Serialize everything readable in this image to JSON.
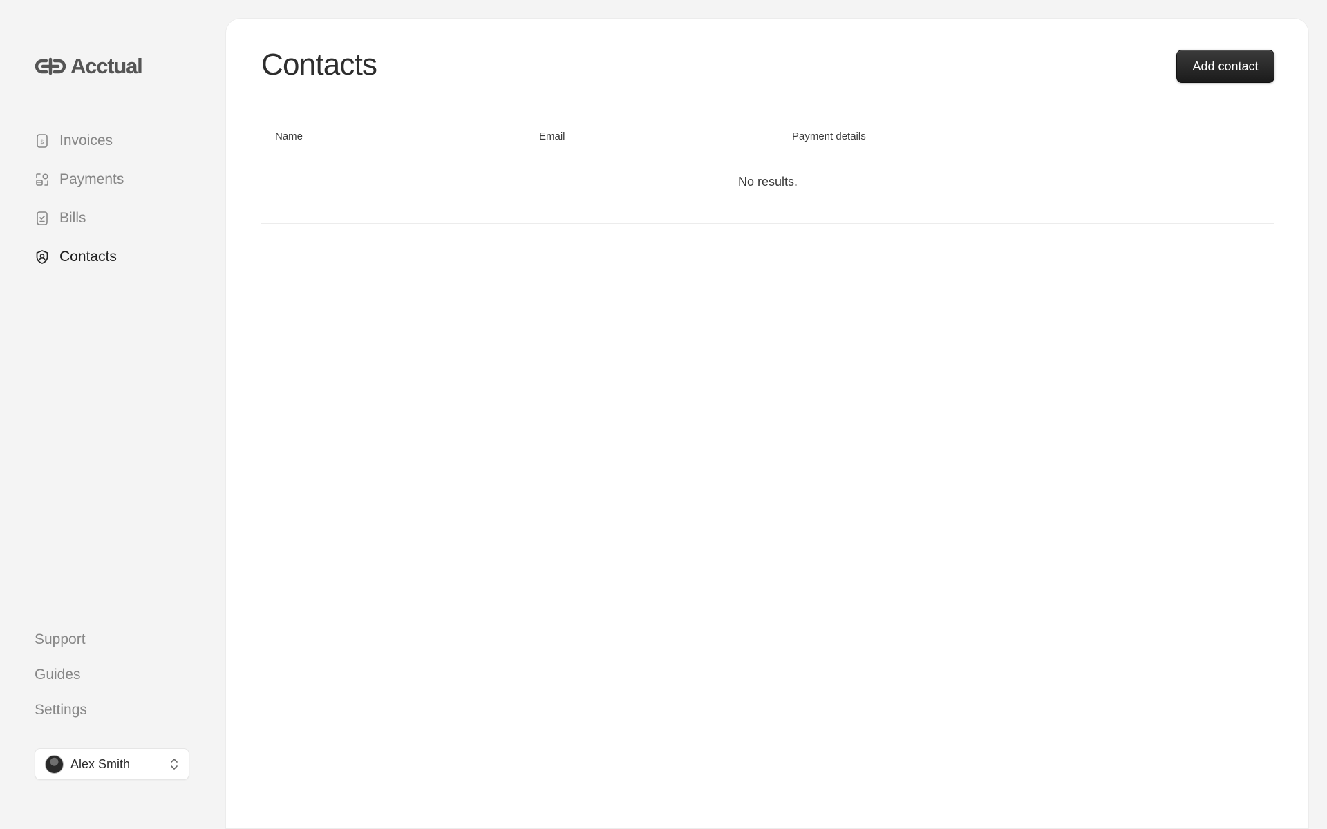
{
  "brand": {
    "name": "Acctual"
  },
  "sidebar": {
    "items": [
      {
        "label": "Invoices",
        "icon": "invoice-dollar-icon",
        "active": false
      },
      {
        "label": "Payments",
        "icon": "payments-icon",
        "active": false
      },
      {
        "label": "Bills",
        "icon": "bill-check-icon",
        "active": false
      },
      {
        "label": "Contacts",
        "icon": "contact-shield-icon",
        "active": true
      }
    ],
    "bottom_links": [
      "Support",
      "Guides",
      "Settings"
    ],
    "user": {
      "name": "Alex Smith",
      "icon": "chevron-up-down-icon"
    }
  },
  "main": {
    "title": "Contacts",
    "add_button": "Add contact",
    "table": {
      "columns": [
        "Name",
        "Email",
        "Payment details"
      ],
      "empty_text": "No results."
    }
  },
  "colors": {
    "background": "#f4f4f4",
    "panel": "#ffffff",
    "button": "#1f1f1f",
    "nav_inactive": "#878787",
    "nav_active": "#1e1e1e"
  }
}
